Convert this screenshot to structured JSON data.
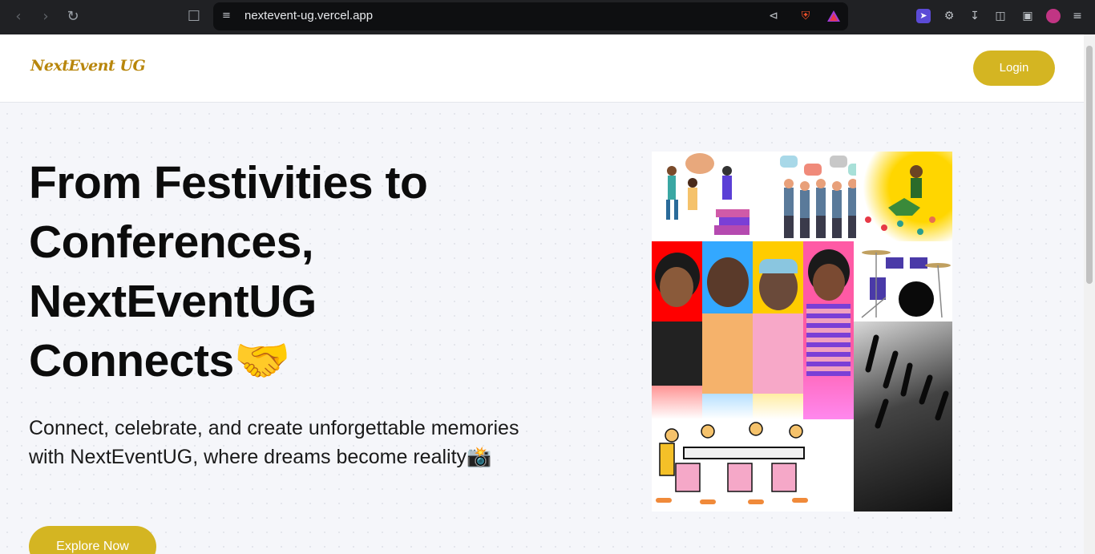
{
  "browser": {
    "url": "nextevent-ug.vercel.app",
    "icons": [
      "back-icon",
      "forward-icon",
      "reload-icon",
      "bookmark-icon",
      "site-info-icon",
      "share-icon",
      "brave-shields-icon",
      "brave-rewards-icon",
      "rocket-extension-icon",
      "extensions-icon",
      "download-icon",
      "sidebar-icon",
      "wallet-icon",
      "profile-icon",
      "menu-icon"
    ]
  },
  "navbar": {
    "logo": "NextEvent UG",
    "login_label": "Login"
  },
  "hero": {
    "headline": "From Festivities to Conferences, NextEventUG Connects🤝",
    "subtitle": "Connect, celebrate, and create unforgettable memories with NextEventUG, where dreams become reality📸",
    "cta_label": "Explore Now"
  },
  "colors": {
    "accent": "#d4b522",
    "logo": "#b8860b",
    "page_bg": "#f5f6fa"
  }
}
